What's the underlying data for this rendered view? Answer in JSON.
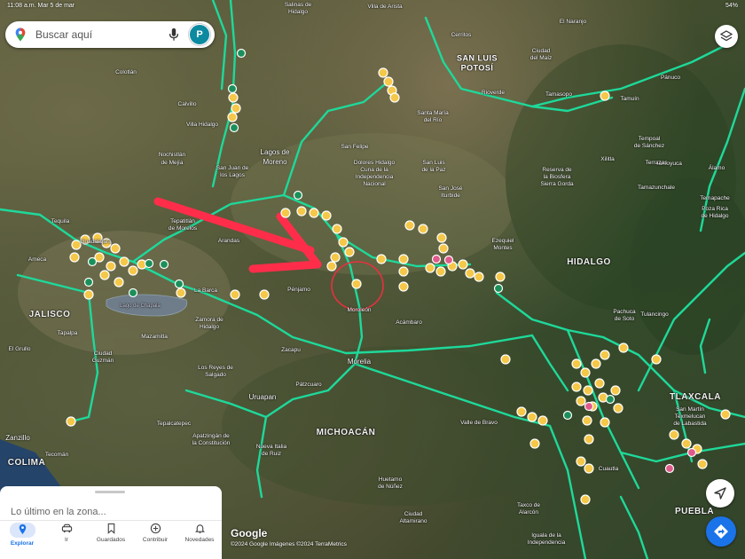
{
  "status_bar": {
    "time_date": "11:08 a.m.  Mar 5 de mar",
    "battery": "54%"
  },
  "search": {
    "placeholder": "Buscar aquí",
    "avatar_letter": "P"
  },
  "map": {
    "labels": [
      {
        "text": "SAN LUIS",
        "cls": "big"
      },
      {
        "text": "POTOSÍ",
        "cls": "big"
      },
      {
        "text": "Lagos de",
        "cls": "mid"
      },
      {
        "text": "Moreno",
        "cls": "mid"
      },
      {
        "text": "HIDALGO",
        "cls": "state"
      },
      {
        "text": "JALISCO",
        "cls": "state"
      },
      {
        "text": "MICHOACÁN",
        "cls": "state"
      },
      {
        "text": "TLAXCALA",
        "cls": "state"
      },
      {
        "text": "PUEBLA",
        "cls": "state"
      },
      {
        "text": "COLIMA",
        "cls": "state"
      },
      {
        "text": "Morelia",
        "cls": "mid"
      },
      {
        "text": "Uruapan",
        "cls": "mid"
      },
      {
        "text": "Zanzillo",
        "cls": "mid"
      },
      {
        "text": "Guadalajara",
        "cls": ""
      },
      {
        "text": "Tequila",
        "cls": ""
      },
      {
        "text": "Ameca",
        "cls": ""
      },
      {
        "text": "Colotlán",
        "cls": ""
      },
      {
        "text": "Calvillo",
        "cls": ""
      },
      {
        "text": "Villa Hidalgo",
        "cls": ""
      },
      {
        "text": "Nochistlán",
        "cls": ""
      },
      {
        "text": "de Mejía",
        "cls": ""
      },
      {
        "text": "San Juan de",
        "cls": ""
      },
      {
        "text": "los Lagos",
        "cls": ""
      },
      {
        "text": "Tepatitlán",
        "cls": ""
      },
      {
        "text": "de Morelos",
        "cls": ""
      },
      {
        "text": "Arandas",
        "cls": ""
      },
      {
        "text": "La Barca",
        "cls": ""
      },
      {
        "text": "Pénjamo",
        "cls": ""
      },
      {
        "text": "Zamora de",
        "cls": ""
      },
      {
        "text": "Hidalgo",
        "cls": ""
      },
      {
        "text": "Zacapu",
        "cls": ""
      },
      {
        "text": "Moroleón",
        "cls": ""
      },
      {
        "text": "Acámbaro",
        "cls": ""
      },
      {
        "text": "Tapalpa",
        "cls": ""
      },
      {
        "text": "El Grullo",
        "cls": ""
      },
      {
        "text": "Ciudad",
        "cls": ""
      },
      {
        "text": "Guzmán",
        "cls": ""
      },
      {
        "text": "Mazamitla",
        "cls": ""
      },
      {
        "text": "Los Reyes de",
        "cls": ""
      },
      {
        "text": "Salgado",
        "cls": ""
      },
      {
        "text": "Pátzcuaro",
        "cls": ""
      },
      {
        "text": "Tepalcatepec",
        "cls": ""
      },
      {
        "text": "Apatzingán de",
        "cls": ""
      },
      {
        "text": "la Constitución",
        "cls": ""
      },
      {
        "text": "Nueva Italia",
        "cls": ""
      },
      {
        "text": "de Ruiz",
        "cls": ""
      },
      {
        "text": "Tecomán",
        "cls": ""
      },
      {
        "text": "Huetamo",
        "cls": ""
      },
      {
        "text": "de Núñez",
        "cls": ""
      },
      {
        "text": "Ciudad",
        "cls": ""
      },
      {
        "text": "Altamirano",
        "cls": ""
      },
      {
        "text": "Valle de Bravo",
        "cls": ""
      },
      {
        "text": "Taxco de",
        "cls": ""
      },
      {
        "text": "Alarcón",
        "cls": ""
      },
      {
        "text": "Iguala de la",
        "cls": ""
      },
      {
        "text": "Independencia",
        "cls": ""
      },
      {
        "text": "Cuautla",
        "cls": ""
      },
      {
        "text": "San Martín",
        "cls": ""
      },
      {
        "text": "Texmelucan",
        "cls": ""
      },
      {
        "text": "de Labastida",
        "cls": ""
      },
      {
        "text": "Tulancingo",
        "cls": ""
      },
      {
        "text": "Pachuca",
        "cls": ""
      },
      {
        "text": "de Soto",
        "cls": ""
      },
      {
        "text": "Ezequiel",
        "cls": ""
      },
      {
        "text": "Montes",
        "cls": ""
      },
      {
        "text": "Dolores Hidalgo",
        "cls": ""
      },
      {
        "text": "Cuna de la",
        "cls": ""
      },
      {
        "text": "Independencia",
        "cls": ""
      },
      {
        "text": "Nacional",
        "cls": ""
      },
      {
        "text": "San Felipe",
        "cls": ""
      },
      {
        "text": "San Luis",
        "cls": ""
      },
      {
        "text": "de la Paz",
        "cls": ""
      },
      {
        "text": "Santa María",
        "cls": ""
      },
      {
        "text": "del Río",
        "cls": ""
      },
      {
        "text": "San José",
        "cls": ""
      },
      {
        "text": "Iturbide",
        "cls": ""
      },
      {
        "text": "Rioverde",
        "cls": ""
      },
      {
        "text": "Ciudad",
        "cls": ""
      },
      {
        "text": "del Maíz",
        "cls": ""
      },
      {
        "text": "Tamasopo",
        "cls": ""
      },
      {
        "text": "Tamuín",
        "cls": ""
      },
      {
        "text": "El Naranjo",
        "cls": ""
      },
      {
        "text": "Pánuco",
        "cls": ""
      },
      {
        "text": "Cerritos",
        "cls": ""
      },
      {
        "text": "Villa de Arista",
        "cls": ""
      },
      {
        "text": "Salinas de",
        "cls": ""
      },
      {
        "text": "Hidalgo",
        "cls": ""
      },
      {
        "text": "Tempoal",
        "cls": ""
      },
      {
        "text": "de Sánchez",
        "cls": ""
      },
      {
        "text": "Xilitla",
        "cls": ""
      },
      {
        "text": "Tamazunchale",
        "cls": ""
      },
      {
        "text": "Tantoyuca",
        "cls": ""
      },
      {
        "text": "Terrazas",
        "cls": ""
      },
      {
        "text": "Reserva de",
        "cls": ""
      },
      {
        "text": "la Biosfera",
        "cls": ""
      },
      {
        "text": "Sierra Gorda",
        "cls": ""
      },
      {
        "text": "Álamo",
        "cls": ""
      },
      {
        "text": "Temapache",
        "cls": ""
      },
      {
        "text": "Poza Rica",
        "cls": ""
      },
      {
        "text": "de Hidalgo",
        "cls": ""
      },
      {
        "text": "Lago de Chapala",
        "cls": "lake"
      }
    ]
  },
  "bottom_sheet": {
    "title": "Lo último en la zona...",
    "nav": [
      {
        "label": "Explorar",
        "icon": "pin-icon"
      },
      {
        "label": "Ir",
        "icon": "car-icon"
      },
      {
        "label": "Guardados",
        "icon": "bookmark-icon"
      },
      {
        "label": "Contribuir",
        "icon": "plus-circle-icon"
      },
      {
        "label": "Novedades",
        "icon": "bell-icon"
      }
    ]
  },
  "attribution": {
    "logo": "Google",
    "copyright": "©2024 Google  Imágenes ©2024 TerraMetrics"
  },
  "colors": {
    "road": "#1ed99a",
    "marker": "#f5c84a",
    "annotation": "#ff2d4a",
    "accent": "#1a73e8"
  }
}
